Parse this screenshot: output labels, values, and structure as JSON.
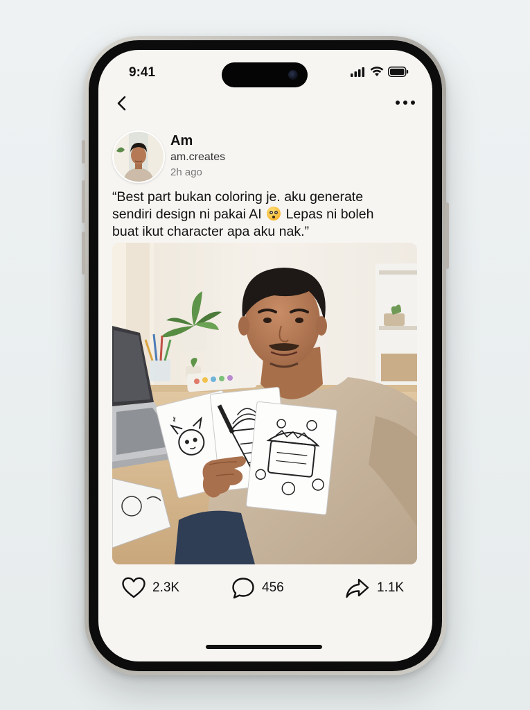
{
  "status_bar": {
    "time": "9:41"
  },
  "post": {
    "author": {
      "name": "Am",
      "handle": "am.creates",
      "timestamp": "2h ago"
    },
    "caption": {
      "line1": "“Best part bukan coloring je. aku generate",
      "line2_start": "sendiri design ni pakai AI",
      "line2_end": "Lepas ni boleh",
      "line3": "buat ikut character apa aku nak.”"
    },
    "stats": {
      "likes": "2.3K",
      "comments": "456",
      "shares": "1.1K"
    }
  },
  "icons": {
    "back": "chevron-left-icon",
    "more": "more-horizontal-icon",
    "like": "heart-icon",
    "comment": "comment-bubble-icon",
    "share": "share-arrow-icon",
    "emoji": "flushed-face-emoji"
  },
  "colors": {
    "screen_bg": "#f7f5f2",
    "text": "#111111",
    "muted": "#777777"
  }
}
